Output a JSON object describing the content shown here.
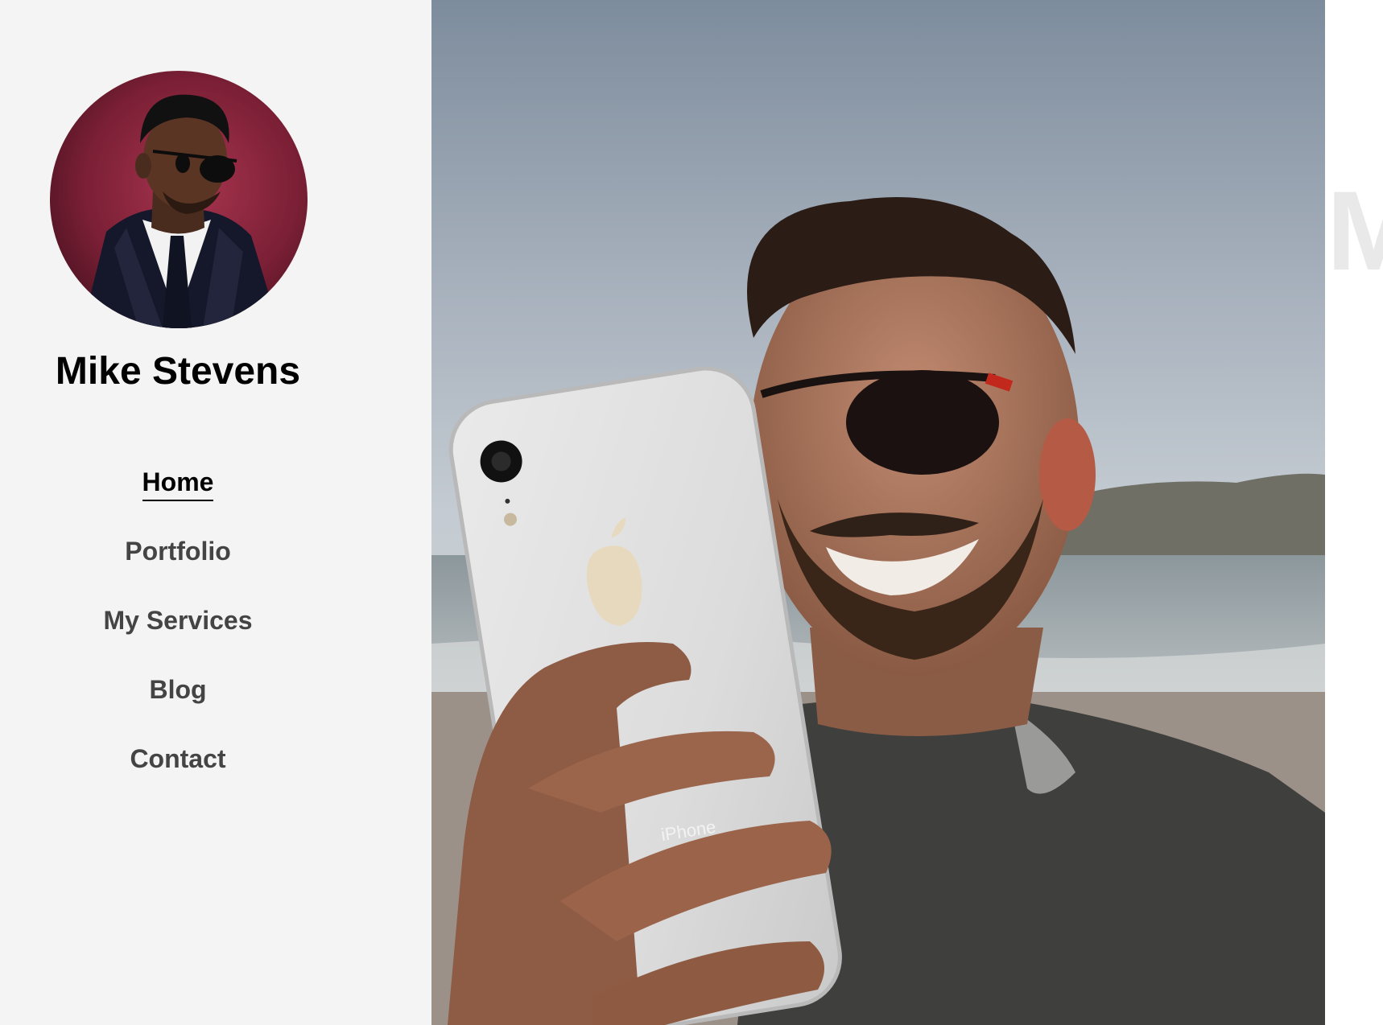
{
  "profile": {
    "name": "Mike Stevens",
    "avatar_alt": "Mike Stevens"
  },
  "nav": {
    "items": [
      {
        "label": "Home",
        "active": true
      },
      {
        "label": "Portfolio",
        "active": false
      },
      {
        "label": "My Services",
        "active": false
      },
      {
        "label": "Blog",
        "active": false
      },
      {
        "label": "Contact",
        "active": false
      }
    ]
  },
  "hero": {
    "phone_text": "iPhone",
    "ghost_heading": "M"
  },
  "colors": {
    "sidebar_bg": "#f4f4f4",
    "active_nav": "#000000",
    "nav_text": "#444444",
    "ghost_text": "#e9e9e9"
  }
}
